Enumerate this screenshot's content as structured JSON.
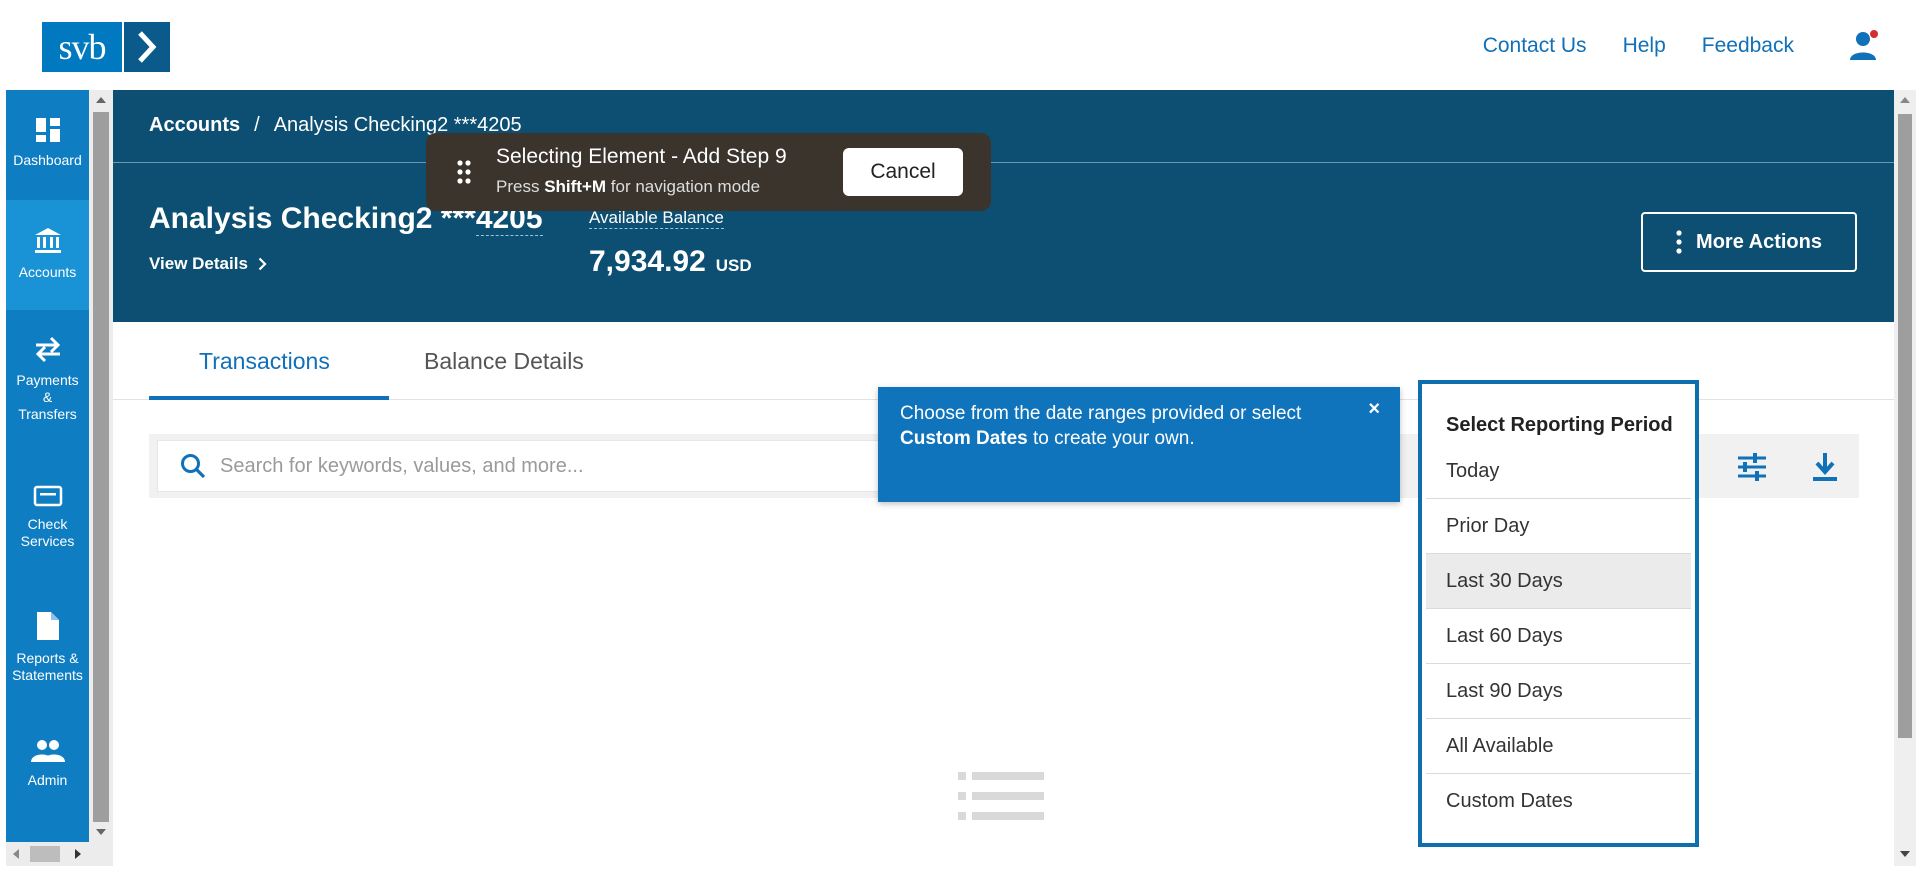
{
  "header": {
    "logo_text": "svb",
    "links": [
      "Contact Us",
      "Help",
      "Feedback"
    ]
  },
  "nav": {
    "items": [
      {
        "label": "Dashboard",
        "icon": "dashboard-icon"
      },
      {
        "label": "Accounts",
        "icon": "bank-icon"
      },
      {
        "label": "Payments & Transfers",
        "icon": "transfer-arrows-icon"
      },
      {
        "label": "Check Services",
        "icon": "check-icon"
      },
      {
        "label": "Reports & Statements",
        "icon": "document-icon"
      },
      {
        "label": "Admin",
        "icon": "users-icon"
      }
    ],
    "active": "Accounts"
  },
  "banner": {
    "breadcrumb_root": "Accounts",
    "breadcrumb_sep": "/",
    "breadcrumb_current": "Analysis Checking2 ***4205",
    "account_name_prefix": "Analysis Checking2 ***",
    "account_number": "4205",
    "view_details": "View Details",
    "available_label": "Available Balance",
    "available_amount": "7,934.92",
    "currency": "USD",
    "more_actions": "More Actions"
  },
  "tabs": {
    "transactions": "Transactions",
    "balance_details": "Balance Details",
    "active": "Transactions"
  },
  "search": {
    "placeholder": "Search for keywords, values, and more..."
  },
  "tooltip": {
    "text_before": "Choose from the date ranges provided or select ",
    "text_bold": "Custom Dates",
    "text_after": " to create your own.",
    "close": "×"
  },
  "reporting_period": {
    "title": "Select Reporting Period",
    "options": [
      "Today",
      "Prior Day",
      "Last 30 Days",
      "Last 60 Days",
      "Last 90 Days",
      "All Available",
      "Custom Dates"
    ],
    "highlighted": "Last 30 Days"
  },
  "recorder": {
    "title": "Selecting Element - Add Step 9",
    "sub_prefix": "Press ",
    "sub_key": "Shift+M",
    "sub_suffix": " for navigation mode",
    "cancel": "Cancel"
  },
  "colors": {
    "brand_blue": "#0079c1",
    "banner": "#0c4f72",
    "nav": "#0e7dc2",
    "tooltip": "#0f74bb",
    "link": "#1070b8"
  }
}
